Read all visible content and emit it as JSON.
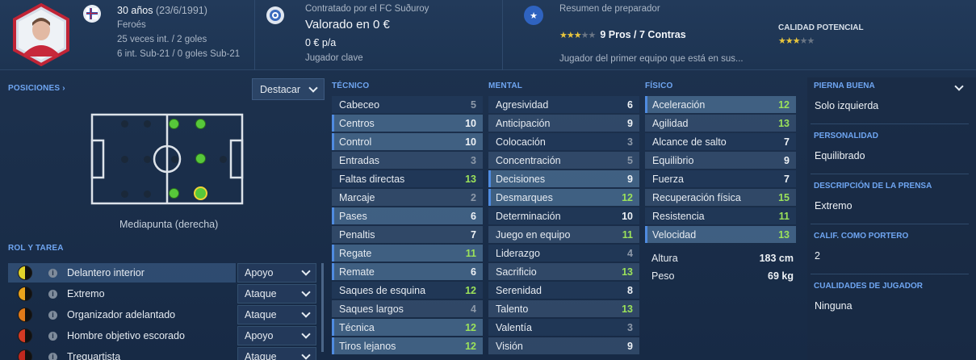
{
  "header": {
    "age": "30 años",
    "dob": "(23/6/1991)",
    "nation": "Feroés",
    "caps": "25 veces int. / 2 goles",
    "u21": "6 int. Sub-21 / 0 goles Sub-21",
    "contract": "Contratado por el FC Suðuroy",
    "valued": "Valorado en 0 €",
    "wage": "0 € p/a",
    "status": "Jugador clave",
    "coach_title": "Resumen de preparador",
    "pros_cons": "9 Pros / 7 Contras",
    "coach_note": "Jugador del primer equipo que está en sus...",
    "potential_label": "CALIDAD POTENCIAL",
    "current_stars": 3,
    "potential_stars": 3,
    "star_total": 5
  },
  "positions": {
    "label": "POSICIONES",
    "dropdown": "Destacar",
    "caption": "Mediapunta (derecha)"
  },
  "roles": {
    "label": "ROL Y TAREA",
    "items": [
      {
        "name": "Delantero interior",
        "duty": "Apoyo",
        "c1": "#e3d42a",
        "c2": "#111111"
      },
      {
        "name": "Extremo",
        "duty": "Ataque",
        "c1": "#e8a21c",
        "c2": "#111111"
      },
      {
        "name": "Organizador adelantado",
        "duty": "Ataque",
        "c1": "#e17a18",
        "c2": "#111111"
      },
      {
        "name": "Hombre objetivo escorado",
        "duty": "Apoyo",
        "c1": "#d43a23",
        "c2": "#111111"
      },
      {
        "name": "Trequartista",
        "duty": "Ataque",
        "c1": "#c0281e",
        "c2": "#111111"
      }
    ]
  },
  "technical": {
    "label": "TÉCNICO",
    "items": [
      {
        "n": "Cabeceo",
        "v": "5"
      },
      {
        "n": "Centros",
        "v": "10"
      },
      {
        "n": "Control",
        "v": "10"
      },
      {
        "n": "Entradas",
        "v": "3"
      },
      {
        "n": "Faltas directas",
        "v": "13"
      },
      {
        "n": "Marcaje",
        "v": "2"
      },
      {
        "n": "Pases",
        "v": "6"
      },
      {
        "n": "Penaltis",
        "v": "7"
      },
      {
        "n": "Regate",
        "v": "11"
      },
      {
        "n": "Remate",
        "v": "6"
      },
      {
        "n": "Saques de esquina",
        "v": "12"
      },
      {
        "n": "Saques largos",
        "v": "4"
      },
      {
        "n": "Técnica",
        "v": "12"
      },
      {
        "n": "Tiros lejanos",
        "v": "12"
      }
    ]
  },
  "mental": {
    "label": "MENTAL",
    "items": [
      {
        "n": "Agresividad",
        "v": "6"
      },
      {
        "n": "Anticipación",
        "v": "9"
      },
      {
        "n": "Colocación",
        "v": "3"
      },
      {
        "n": "Concentración",
        "v": "5"
      },
      {
        "n": "Decisiones",
        "v": "9"
      },
      {
        "n": "Desmarques",
        "v": "12"
      },
      {
        "n": "Determinación",
        "v": "10"
      },
      {
        "n": "Juego en equipo",
        "v": "11"
      },
      {
        "n": "Liderazgo",
        "v": "4"
      },
      {
        "n": "Sacrificio",
        "v": "13"
      },
      {
        "n": "Serenidad",
        "v": "8"
      },
      {
        "n": "Talento",
        "v": "13"
      },
      {
        "n": "Valentía",
        "v": "3"
      },
      {
        "n": "Visión",
        "v": "9"
      }
    ]
  },
  "physical": {
    "label": "FÍSICO",
    "items": [
      {
        "n": "Aceleración",
        "v": "12"
      },
      {
        "n": "Agilidad",
        "v": "13"
      },
      {
        "n": "Alcance de salto",
        "v": "7"
      },
      {
        "n": "Equilibrio",
        "v": "9"
      },
      {
        "n": "Fuerza",
        "v": "7"
      },
      {
        "n": "Recuperación física",
        "v": "15"
      },
      {
        "n": "Resistencia",
        "v": "11"
      },
      {
        "n": "Velocidad",
        "v": "13"
      }
    ],
    "height_label": "Altura",
    "height": "183 cm",
    "weight_label": "Peso",
    "weight": "69 kg"
  },
  "info": [
    {
      "t": "PIERNA BUENA",
      "v": "Solo izquierda"
    },
    {
      "t": "PERSONALIDAD",
      "v": "Equilibrado"
    },
    {
      "t": "DESCRIPCIÓN DE LA PRENSA",
      "v": "Extremo"
    },
    {
      "t": "CALIF. COMO PORTERO",
      "v": "2"
    },
    {
      "t": "CUALIDADES DE JUGADOR",
      "v": "Ninguna"
    }
  ]
}
